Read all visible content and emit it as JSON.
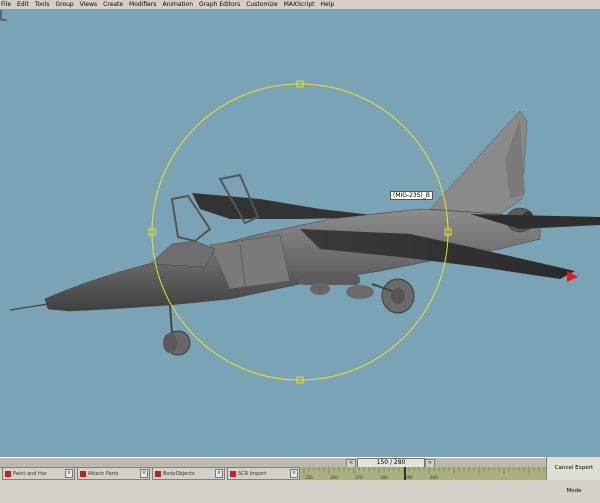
{
  "menu": {
    "items": [
      "File",
      "Edit",
      "Tools",
      "Group",
      "Views",
      "Create",
      "Modifiers",
      "Animation",
      "Graph Editors",
      "Customize",
      "MAXScript",
      "Help"
    ]
  },
  "viewport": {
    "selection_label": "(MIG-23S)_B",
    "background": "#7aa3b6",
    "gizmo_color": "#e8e32a"
  },
  "timeline": {
    "frame_display": "150 / 280",
    "slider_left_arrow": "<",
    "slider_right_arrow": ">",
    "tick_labels": [
      "150",
      "160",
      "170",
      "180",
      "190",
      "200"
    ]
  },
  "taskbar": {
    "items": [
      {
        "label": "Paint and Har",
        "icon": "max-icon"
      },
      {
        "label": "Attach Parts",
        "icon": "max-icon"
      },
      {
        "label": "BodyObjects",
        "icon": "max-icon"
      },
      {
        "label": "SCR Import",
        "icon": "max-icon"
      }
    ],
    "cancel_expert_label": "Cancel Expert Mode"
  }
}
